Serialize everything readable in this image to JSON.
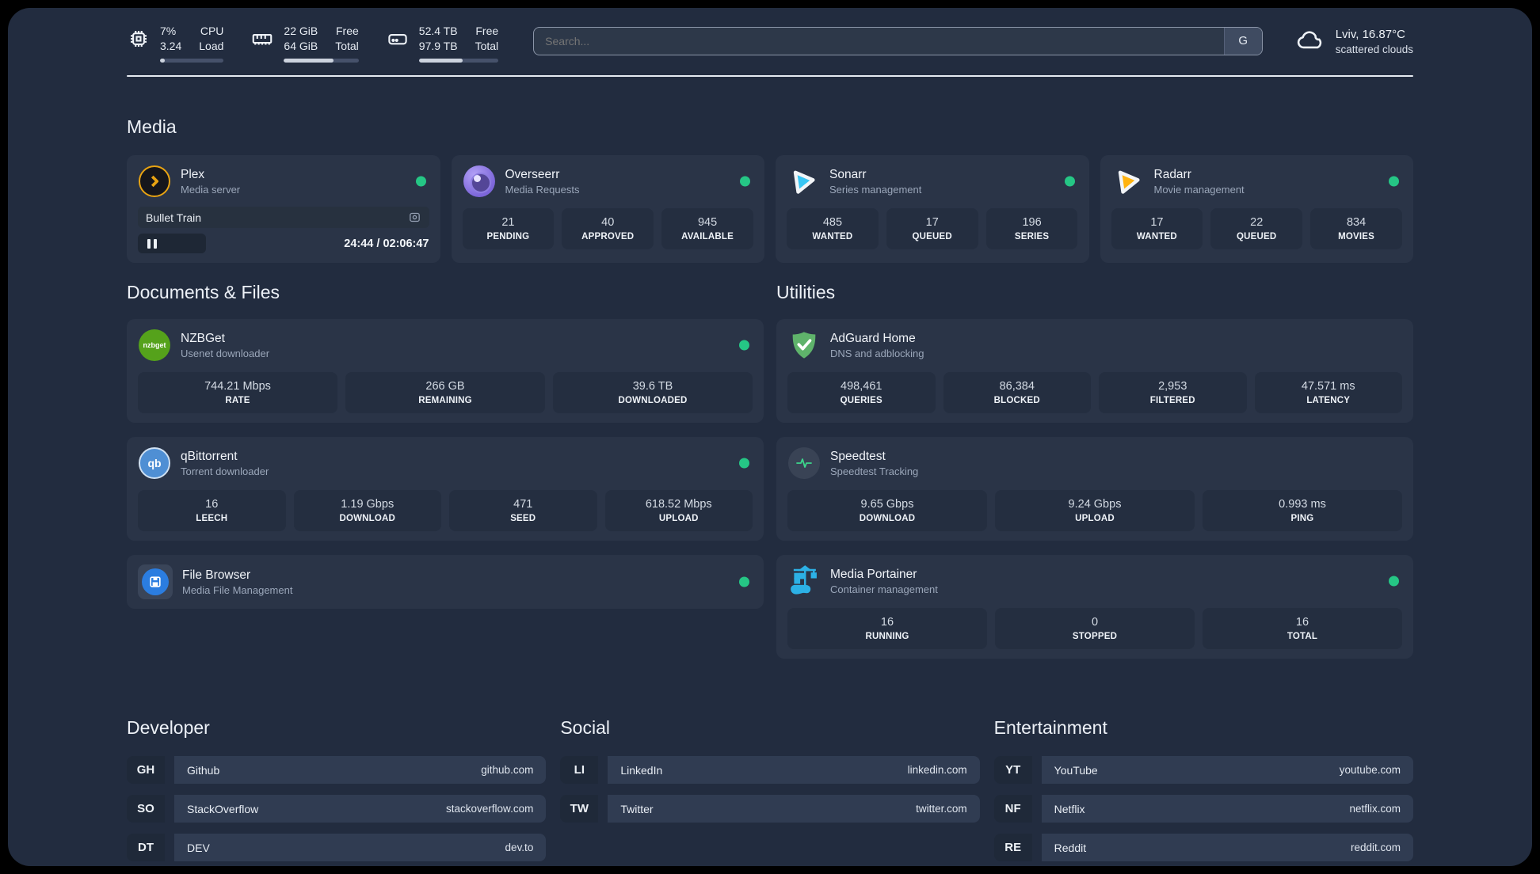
{
  "colors": {
    "accent_green": "#25c685",
    "dashboard_bg": "#222c3f",
    "card_bg": "#2a3447"
  },
  "header": {
    "stats": [
      {
        "icon": "cpu-icon",
        "value_top": "7%",
        "value_bottom": "3.24",
        "label_top": "CPU",
        "label_bottom": "Load",
        "progress": "8%"
      },
      {
        "icon": "memory-icon",
        "value_top": "22 GiB",
        "value_bottom": "64 GiB",
        "label_top": "Free",
        "label_bottom": "Total",
        "progress": "66%"
      },
      {
        "icon": "disk-icon",
        "value_top": "52.4 TB",
        "value_bottom": "97.9 TB",
        "label_top": "Free",
        "label_bottom": "Total",
        "progress": "55%"
      }
    ],
    "search": {
      "placeholder": "Search...",
      "button_label": "G"
    },
    "weather": {
      "icon": "cloud-icon",
      "line1": "Lviv, 16.87°C",
      "line2": "scattered clouds"
    }
  },
  "media": {
    "title": "Media",
    "plex": {
      "name": "Plex",
      "desc": "Media server",
      "now_playing": "Bullet Train",
      "time": "24:44 / 02:06:47"
    },
    "overseerr": {
      "name": "Overseerr",
      "desc": "Media Requests",
      "stats": [
        {
          "value": "21",
          "label": "PENDING"
        },
        {
          "value": "40",
          "label": "APPROVED"
        },
        {
          "value": "945",
          "label": "AVAILABLE"
        }
      ]
    },
    "sonarr": {
      "name": "Sonarr",
      "desc": "Series management",
      "stats": [
        {
          "value": "485",
          "label": "WANTED"
        },
        {
          "value": "17",
          "label": "QUEUED"
        },
        {
          "value": "196",
          "label": "SERIES"
        }
      ]
    },
    "radarr": {
      "name": "Radarr",
      "desc": "Movie management",
      "stats": [
        {
          "value": "17",
          "label": "WANTED"
        },
        {
          "value": "22",
          "label": "QUEUED"
        },
        {
          "value": "834",
          "label": "MOVIES"
        }
      ]
    }
  },
  "documents": {
    "title": "Documents & Files",
    "nzbget": {
      "name": "NZBGet",
      "desc": "Usenet downloader",
      "icon_text": "nzbget",
      "stats": [
        {
          "value": "744.21 Mbps",
          "label": "RATE"
        },
        {
          "value": "266 GB",
          "label": "REMAINING"
        },
        {
          "value": "39.6 TB",
          "label": "DOWNLOADED"
        }
      ]
    },
    "qbittorrent": {
      "name": "qBittorrent",
      "desc": "Torrent downloader",
      "icon_text": "qb",
      "stats": [
        {
          "value": "16",
          "label": "LEECH"
        },
        {
          "value": "1.19 Gbps",
          "label": "DOWNLOAD"
        },
        {
          "value": "471",
          "label": "SEED"
        },
        {
          "value": "618.52 Mbps",
          "label": "UPLOAD"
        }
      ]
    },
    "filebrowser": {
      "name": "File Browser",
      "desc": "Media File Management"
    }
  },
  "utilities": {
    "title": "Utilities",
    "adguard": {
      "name": "AdGuard Home",
      "desc": "DNS and adblocking",
      "stats": [
        {
          "value": "498,461",
          "label": "QUERIES"
        },
        {
          "value": "86,384",
          "label": "BLOCKED"
        },
        {
          "value": "2,953",
          "label": "FILTERED"
        },
        {
          "value": "47.571 ms",
          "label": "LATENCY"
        }
      ]
    },
    "speedtest": {
      "name": "Speedtest",
      "desc": "Speedtest Tracking",
      "stats": [
        {
          "value": "9.65 Gbps",
          "label": "DOWNLOAD"
        },
        {
          "value": "9.24 Gbps",
          "label": "UPLOAD"
        },
        {
          "value": "0.993 ms",
          "label": "PING"
        }
      ]
    },
    "portainer": {
      "name": "Media Portainer",
      "desc": "Container management",
      "stats": [
        {
          "value": "16",
          "label": "RUNNING"
        },
        {
          "value": "0",
          "label": "STOPPED"
        },
        {
          "value": "16",
          "label": "TOTAL"
        }
      ]
    }
  },
  "links": {
    "developer": {
      "title": "Developer",
      "items": [
        {
          "abbr": "GH",
          "name": "Github",
          "url": "github.com"
        },
        {
          "abbr": "SO",
          "name": "StackOverflow",
          "url": "stackoverflow.com"
        },
        {
          "abbr": "DT",
          "name": "DEV",
          "url": "dev.to"
        }
      ]
    },
    "social": {
      "title": "Social",
      "items": [
        {
          "abbr": "LI",
          "name": "LinkedIn",
          "url": "linkedin.com"
        },
        {
          "abbr": "TW",
          "name": "Twitter",
          "url": "twitter.com"
        }
      ]
    },
    "entertainment": {
      "title": "Entertainment",
      "items": [
        {
          "abbr": "YT",
          "name": "YouTube",
          "url": "youtube.com"
        },
        {
          "abbr": "NF",
          "name": "Netflix",
          "url": "netflix.com"
        },
        {
          "abbr": "RE",
          "name": "Reddit",
          "url": "reddit.com"
        }
      ]
    }
  }
}
